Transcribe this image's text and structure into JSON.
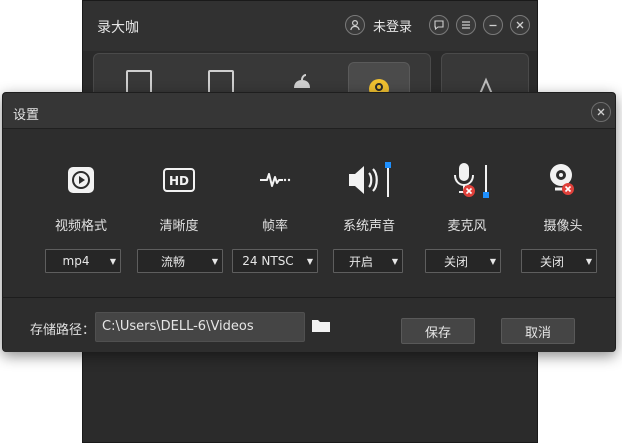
{
  "app": {
    "title": "录大咖",
    "user_status": "未登录"
  },
  "dialog": {
    "title": "设置",
    "settings": [
      {
        "icon": "video-format-icon",
        "label": "视频格式",
        "value": "mp4"
      },
      {
        "icon": "hd-icon",
        "label": "清晰度",
        "value": "流畅"
      },
      {
        "icon": "waveform-icon",
        "label": "帧率",
        "value": "24 NTSC"
      },
      {
        "icon": "speaker-icon",
        "label": "系统声音",
        "value": "开启"
      },
      {
        "icon": "microphone-muted-icon",
        "label": "麦克风",
        "value": "关闭"
      },
      {
        "icon": "webcam-muted-icon",
        "label": "摄像头",
        "value": "关闭"
      }
    ],
    "footer": {
      "path_label": "存储路径：",
      "path_value": "C:\\Users\\DELL-6\\Videos",
      "save_label": "保存",
      "cancel_label": "取消"
    }
  },
  "colors": {
    "accent_blue": "#1e90ff",
    "mute_red": "#e0403a",
    "dialog_bg": "#2d2d2d"
  }
}
